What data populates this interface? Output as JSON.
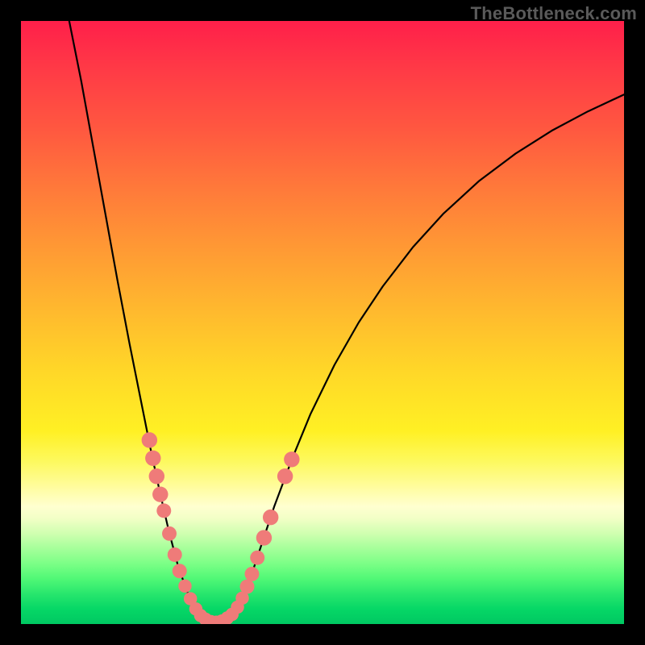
{
  "watermark": "TheBottleneck.com",
  "chart_data": {
    "type": "line",
    "title": "",
    "xlabel": "",
    "ylabel": "",
    "xlim": [
      0,
      100
    ],
    "ylim": [
      0,
      100
    ],
    "curve": {
      "name": "bottleneck-curve",
      "points": [
        {
          "x": 8.0,
          "y": 100.0
        },
        {
          "x": 10.0,
          "y": 90.0
        },
        {
          "x": 12.0,
          "y": 79.0
        },
        {
          "x": 14.0,
          "y": 68.0
        },
        {
          "x": 16.0,
          "y": 57.0
        },
        {
          "x": 18.0,
          "y": 46.5
        },
        {
          "x": 20.0,
          "y": 36.5
        },
        {
          "x": 21.5,
          "y": 29.0
        },
        {
          "x": 23.0,
          "y": 22.0
        },
        {
          "x": 24.5,
          "y": 15.5
        },
        {
          "x": 26.0,
          "y": 9.8
        },
        {
          "x": 27.5,
          "y": 5.5
        },
        {
          "x": 29.0,
          "y": 2.5
        },
        {
          "x": 30.5,
          "y": 0.8
        },
        {
          "x": 32.0,
          "y": 0.3
        },
        {
          "x": 33.5,
          "y": 0.5
        },
        {
          "x": 35.0,
          "y": 1.5
        },
        {
          "x": 36.5,
          "y": 3.8
        },
        {
          "x": 38.0,
          "y": 7.5
        },
        {
          "x": 40.0,
          "y": 13.5
        },
        {
          "x": 42.0,
          "y": 19.5
        },
        {
          "x": 45.0,
          "y": 27.5
        },
        {
          "x": 48.0,
          "y": 34.8
        },
        {
          "x": 52.0,
          "y": 43.0
        },
        {
          "x": 56.0,
          "y": 50.0
        },
        {
          "x": 60.0,
          "y": 56.0
        },
        {
          "x": 65.0,
          "y": 62.5
        },
        {
          "x": 70.0,
          "y": 68.0
        },
        {
          "x": 76.0,
          "y": 73.5
        },
        {
          "x": 82.0,
          "y": 78.0
        },
        {
          "x": 88.0,
          "y": 81.8
        },
        {
          "x": 94.0,
          "y": 85.0
        },
        {
          "x": 100.0,
          "y": 87.8
        }
      ]
    },
    "markers_left": [
      {
        "x": 21.3,
        "y": 30.5,
        "r": 1.3
      },
      {
        "x": 21.9,
        "y": 27.5,
        "r": 1.3
      },
      {
        "x": 22.5,
        "y": 24.5,
        "r": 1.3
      },
      {
        "x": 23.1,
        "y": 21.5,
        "r": 1.3
      },
      {
        "x": 23.7,
        "y": 18.8,
        "r": 1.2
      },
      {
        "x": 24.6,
        "y": 15.0,
        "r": 1.2
      },
      {
        "x": 25.5,
        "y": 11.5,
        "r": 1.2
      },
      {
        "x": 26.3,
        "y": 8.8,
        "r": 1.2
      },
      {
        "x": 27.2,
        "y": 6.3,
        "r": 1.1
      },
      {
        "x": 28.1,
        "y": 4.2,
        "r": 1.1
      },
      {
        "x": 29.0,
        "y": 2.5,
        "r": 1.1
      }
    ],
    "markers_bottom": [
      {
        "x": 29.8,
        "y": 1.4,
        "r": 1.1
      },
      {
        "x": 30.6,
        "y": 0.8,
        "r": 1.1
      },
      {
        "x": 31.5,
        "y": 0.4,
        "r": 1.1
      },
      {
        "x": 32.4,
        "y": 0.3,
        "r": 1.1
      },
      {
        "x": 33.3,
        "y": 0.5,
        "r": 1.1
      },
      {
        "x": 34.2,
        "y": 1.0,
        "r": 1.1
      },
      {
        "x": 35.0,
        "y": 1.6,
        "r": 1.1
      }
    ],
    "markers_right": [
      {
        "x": 35.9,
        "y": 2.8,
        "r": 1.1
      },
      {
        "x": 36.7,
        "y": 4.3,
        "r": 1.1
      },
      {
        "x": 37.5,
        "y": 6.2,
        "r": 1.2
      },
      {
        "x": 38.3,
        "y": 8.3,
        "r": 1.2
      },
      {
        "x": 39.2,
        "y": 11.0,
        "r": 1.2
      },
      {
        "x": 40.3,
        "y": 14.3,
        "r": 1.3
      },
      {
        "x": 41.4,
        "y": 17.7,
        "r": 1.3
      },
      {
        "x": 43.8,
        "y": 24.5,
        "r": 1.3
      },
      {
        "x": 44.9,
        "y": 27.3,
        "r": 1.3
      }
    ]
  }
}
